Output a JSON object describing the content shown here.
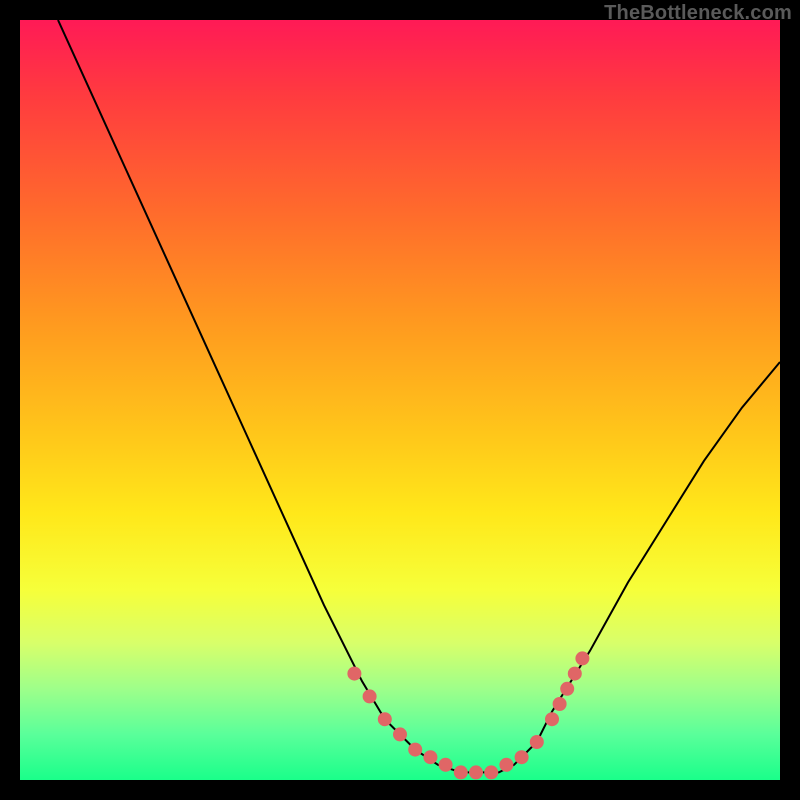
{
  "watermark": "TheBottleneck.com",
  "colors": {
    "background": "#000000",
    "gradient_top": "#ff1a56",
    "gradient_bottom": "#1aff8a",
    "curve": "#000000",
    "marker_fill": "#e06666",
    "marker_stroke": "#cc4444"
  },
  "chart_data": {
    "type": "line",
    "title": "",
    "xlabel": "",
    "ylabel": "",
    "xlim": [
      0,
      100
    ],
    "ylim": [
      0,
      100
    ],
    "grid": false,
    "curve": {
      "x": [
        5,
        10,
        15,
        20,
        25,
        30,
        35,
        40,
        45,
        48,
        52,
        55,
        58,
        60,
        63,
        65,
        68,
        70,
        75,
        80,
        85,
        90,
        95,
        100
      ],
      "y": [
        100,
        89,
        78,
        67,
        56,
        45,
        34,
        23,
        13,
        8,
        4,
        2,
        1,
        1,
        1,
        2,
        5,
        9,
        17,
        26,
        34,
        42,
        49,
        55
      ]
    },
    "markers": {
      "x": [
        44,
        46,
        48,
        50,
        52,
        54,
        56,
        58,
        60,
        62,
        64,
        66,
        68,
        70,
        71,
        72,
        73,
        74
      ],
      "y": [
        14,
        11,
        8,
        6,
        4,
        3,
        2,
        1,
        1,
        1,
        2,
        3,
        5,
        8,
        10,
        12,
        14,
        16
      ]
    }
  }
}
